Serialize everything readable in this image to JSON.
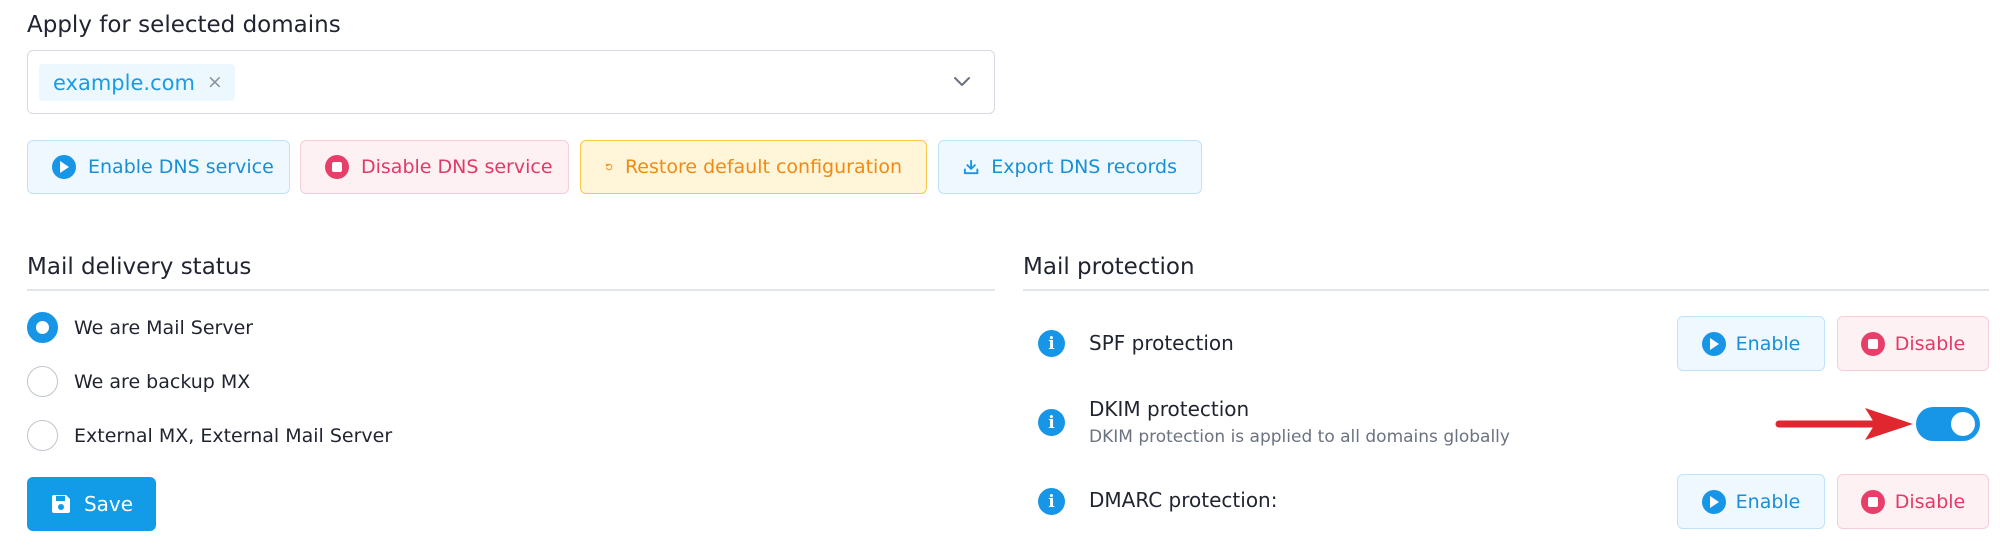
{
  "domains": {
    "heading": "Apply for selected domains",
    "selected": [
      "example.com"
    ],
    "remove_glyph": "×",
    "dropdown_icon": "chevron-down-icon"
  },
  "actions": {
    "enable_dns": "Enable DNS service",
    "disable_dns": "Disable DNS service",
    "restore_default": "Restore default configuration",
    "export_dns": "Export DNS records"
  },
  "mail_delivery": {
    "heading": "Mail delivery status",
    "options": [
      {
        "label": "We are Mail Server",
        "checked": true
      },
      {
        "label": "We are backup MX",
        "checked": false
      },
      {
        "label": "External MX, External Mail Server",
        "checked": false
      }
    ],
    "save_label": "Save"
  },
  "mail_protection": {
    "heading": "Mail protection",
    "info_glyph": "i",
    "spf": {
      "label": "SPF protection",
      "enable": "Enable",
      "disable": "Disable"
    },
    "dkim": {
      "label": "DKIM protection",
      "note": "DKIM protection is applied to all domains globally",
      "enabled": true
    },
    "dmarc": {
      "label": "DMARC protection:",
      "enable": "Enable",
      "disable": "Disable"
    }
  },
  "colors": {
    "accent": "#1795e6",
    "danger": "#e83f6a",
    "warning": "#f08a14",
    "annotation_arrow": "#e0262f"
  }
}
